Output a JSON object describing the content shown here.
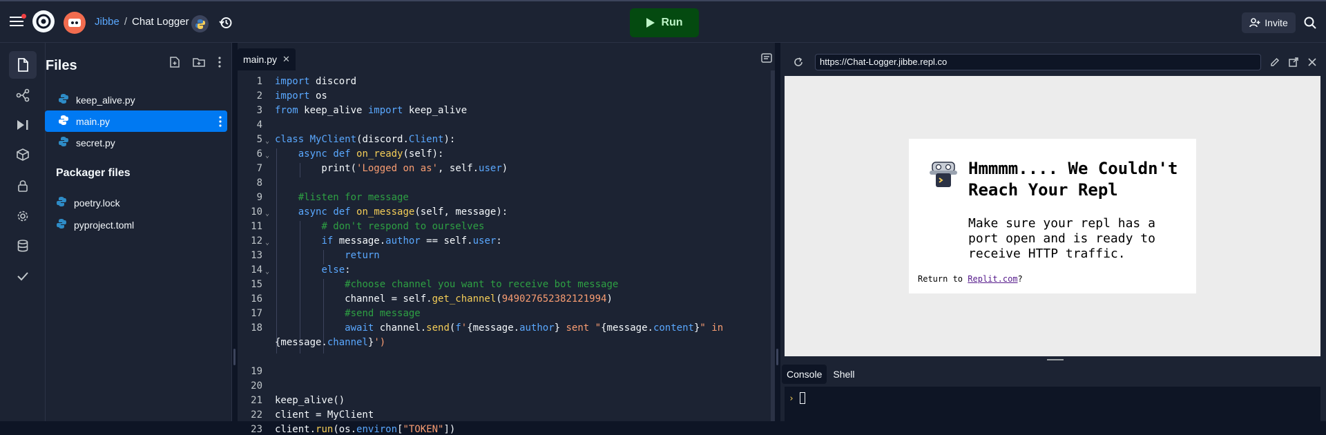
{
  "topbar": {
    "user": "Jibbe",
    "separator": "/",
    "repl_name": "Chat Logger",
    "run_label": "Run",
    "invite_label": "Invite"
  },
  "files_panel": {
    "title": "Files",
    "files": [
      {
        "name": "keep_alive.py",
        "active": false
      },
      {
        "name": "main.py",
        "active": true
      },
      {
        "name": "secret.py",
        "active": false
      }
    ],
    "packager_title": "Packager files",
    "packager_files": [
      "poetry.lock",
      "pyproject.toml"
    ]
  },
  "editor": {
    "tab_label": "main.py",
    "line_numbers": [
      "1",
      "2",
      "3",
      "4",
      "5",
      "6",
      "7",
      "8",
      "9",
      "10",
      "11",
      "12",
      "13",
      "14",
      "15",
      "16",
      "17",
      "18",
      "",
      "19",
      "20",
      "21",
      "22",
      "23"
    ]
  },
  "webview": {
    "url": "https://Chat-Logger.jibbe.repl.co",
    "error_title": "Hmmmm.... We Couldn't Reach Your Repl",
    "error_body": "Make sure your repl has a port open and is ready to receive HTTP traffic.",
    "footer_prefix": "Return to",
    "footer_link": "Replit.com",
    "footer_suffix": "?"
  },
  "console": {
    "tabs": [
      "Console",
      "Shell"
    ],
    "active_tab": "Console",
    "prompt": "›"
  },
  "colors": {
    "background": "#0e1525",
    "surface": "#1c2333",
    "accent": "#0079f2",
    "run_bg": "#044a10",
    "run_fg": "#bff5c8"
  }
}
